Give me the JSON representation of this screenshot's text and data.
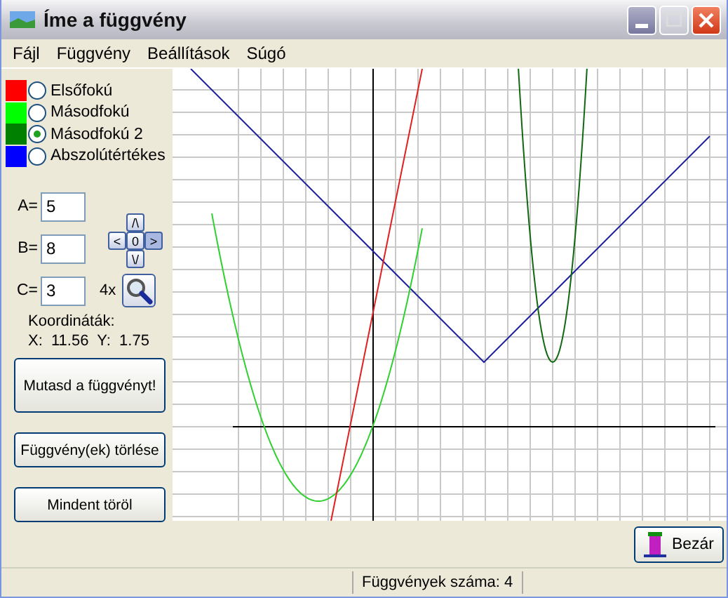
{
  "window": {
    "title": "Íme a függvény"
  },
  "menu": [
    "Fájl",
    "Függvény",
    "Beállítások",
    "Súgó"
  ],
  "functions": [
    {
      "label": "Elsőfokú",
      "color": "#ff0000",
      "selected": false
    },
    {
      "label": "Másodfokú",
      "color": "#00ff00",
      "selected": false
    },
    {
      "label": "Másodfokú 2",
      "color": "#008000",
      "selected": true
    },
    {
      "label": "Abszolútértékes",
      "color": "#0000ff",
      "selected": false
    }
  ],
  "params": [
    {
      "label": "A=",
      "value": "5"
    },
    {
      "label": "B=",
      "value": "8"
    },
    {
      "label": "C=",
      "value": "3"
    }
  ],
  "pan": {
    "up": "/\\",
    "left": "<",
    "center": "0",
    "right": ">",
    "down": "\\/"
  },
  "zoom": {
    "label": "4x"
  },
  "coords": {
    "title": "Koordináták:",
    "text": "X:  11.56  Y:  1.75"
  },
  "buttons": [
    "Mutasd a függvényt!",
    "Függvény(ek) törlése",
    "Mindent töröl"
  ],
  "close_button": "Bezár",
  "status_bar": "Függvények száma: 4"
}
